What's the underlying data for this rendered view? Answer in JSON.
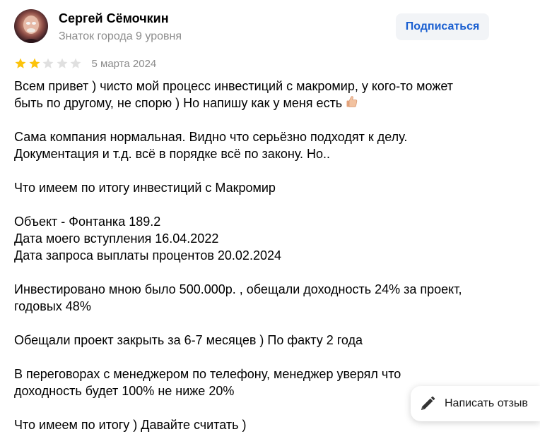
{
  "author": {
    "name": "Сергей Сёмочкин",
    "level": "Знаток города 9 уровня",
    "avatar": "avatar-photo"
  },
  "subscribe_label": "Подписаться",
  "review": {
    "rating": 2,
    "max_rating": 5,
    "date": "5 марта 2024",
    "paragraphs": [
      [
        "Всем привет ) чисто мой процесс инвестиций с макромир, у кого-то может",
        "быть по другому, не спорю ) Но напишу как у меня есть"
      ],
      [
        "Сама компания нормальная. Видно что серьёзно подходят к делу.",
        "Документация и т.д. всё в порядке всё по закону. Но.."
      ],
      [
        "Что имеем по итогу инвестиций с Макромир"
      ],
      [
        "Объект - Фонтанка 189.2",
        "Дата моего вступления 16.04.2022",
        "Дата запроса выплаты процентов 20.02.2024"
      ],
      [
        "Инвестировано мною было 500.000р. , обещали доходность 24% за проект,",
        "годовых 48%"
      ],
      [
        "Обещали проект закрыть за 6-7 месяцев ) По факту 2 года"
      ],
      [
        "В переговорах с менеджером по телефону, менеджер уверял что",
        "доходность будет 100% не ниже 20%"
      ],
      [
        "Что имеем по итогу ) Давайте считать )"
      ]
    ]
  },
  "write_review_label": "Написать отзыв",
  "icons": {
    "thumb": "thumbs-up-icon",
    "pen": "pen-icon",
    "star": "star-icon"
  },
  "colors": {
    "star_filled": "#fcc30b",
    "star_empty": "#e0e0e0",
    "accent": "#1a5fd1",
    "muted": "#8c8c8c"
  }
}
